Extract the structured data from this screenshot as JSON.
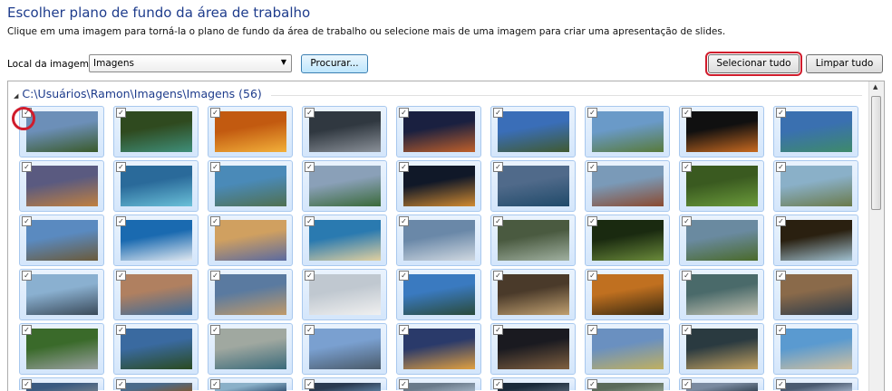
{
  "header": {
    "title": "Escolher plano de fundo da área de trabalho",
    "subtitle": "Clique em uma imagem para torná-la o plano de fundo da área de trabalho ou selecione mais de uma imagem para criar uma apresentação de slides."
  },
  "location": {
    "label": "Local da imagem:",
    "value": "Imagens",
    "browse": "Procurar..."
  },
  "buttons": {
    "select_all": "Selecionar tudo",
    "clear_all": "Limpar tudo"
  },
  "group": {
    "title": "C:\\Usuários\\Ramon\\Imagens\\Imagens (56)"
  },
  "checkmark": "✓",
  "thumbnail_colors": [
    [
      "#6c8fb8",
      "#3a5a2a"
    ],
    [
      "#2f4a1f",
      "#3f8f7a"
    ],
    [
      "#c25a10",
      "#f2b03a"
    ],
    [
      "#303840",
      "#8a9098"
    ],
    [
      "#1a2040",
      "#c0602a"
    ],
    [
      "#3a6eb8",
      "#405a30"
    ],
    [
      "#6a9ac8",
      "#587a3a"
    ],
    [
      "#101010",
      "#c86a20"
    ],
    [
      "#3a70b0",
      "#3e8a6a"
    ],
    [
      "#5a5a80",
      "#c08040"
    ],
    [
      "#2a6a9a",
      "#6ac0d8"
    ],
    [
      "#4a8ab8",
      "#507050"
    ],
    [
      "#8aa0b8",
      "#3a6a3a"
    ],
    [
      "#101828",
      "#d08a30"
    ],
    [
      "#506a8a",
      "#204a6a"
    ],
    [
      "#7a9ab8",
      "#8a4a30"
    ],
    [
      "#3a5a20",
      "#6a9a3a"
    ],
    [
      "#8ab0c8",
      "#6a7a4a"
    ],
    [
      "#5a8ac0",
      "#6a5a3a"
    ],
    [
      "#1a6ab0",
      "#e0e8f0"
    ],
    [
      "#d0a060",
      "#5a6aa0"
    ],
    [
      "#2a7ab0",
      "#e0d0a0"
    ],
    [
      "#6a88a8",
      "#d0d8e0"
    ],
    [
      "#4a5a40",
      "#a0b0a0"
    ],
    [
      "#1a2a10",
      "#6a8a3a"
    ],
    [
      "#6a8aa0",
      "#4a6a2a"
    ],
    [
      "#2a2010",
      "#a0c0d0"
    ],
    [
      "#8ab0d0",
      "#3a4a5a"
    ],
    [
      "#b08060",
      "#3a6a9a"
    ],
    [
      "#5a7aa0",
      "#c09a6a"
    ],
    [
      "#c0c8d0",
      "#f0f0f0"
    ],
    [
      "#3a7ac0",
      "#2a4a3a"
    ],
    [
      "#4a3a2a",
      "#c0a070"
    ],
    [
      "#c07020",
      "#3a2a10"
    ],
    [
      "#4a6a6a",
      "#c0c0b0"
    ],
    [
      "#8a6a4a",
      "#2a3a4a"
    ],
    [
      "#3a6a2a",
      "#9aa0a0"
    ],
    [
      "#3a6aa0",
      "#2a4a20"
    ],
    [
      "#a0a8a0",
      "#3a6a7a"
    ],
    [
      "#7aa0d0",
      "#4a5a6a"
    ],
    [
      "#2a3a6a",
      "#e0a040"
    ],
    [
      "#1a1a20",
      "#806040"
    ],
    [
      "#6a90c0",
      "#c0b060"
    ],
    [
      "#2a3a40",
      "#c0a060"
    ],
    [
      "#5a9ad0",
      "#d0c0a0"
    ],
    [
      "#3a5a80",
      "#6a7a8a"
    ],
    [
      "#4a6a8a",
      "#7a5a3a"
    ],
    [
      "#8ab0c8",
      "#3a5a7a"
    ],
    [
      "#2a3a50",
      "#5a7a9a"
    ],
    [
      "#6a7a8a",
      "#a0b0c0"
    ],
    [
      "#1a2a3a",
      "#4a5a6a"
    ],
    [
      "#5a6a5a",
      "#8a9a8a"
    ],
    [
      "#7a8aa0",
      "#3a4a5a"
    ],
    [
      "#4a5a70",
      "#9aaac0"
    ]
  ]
}
